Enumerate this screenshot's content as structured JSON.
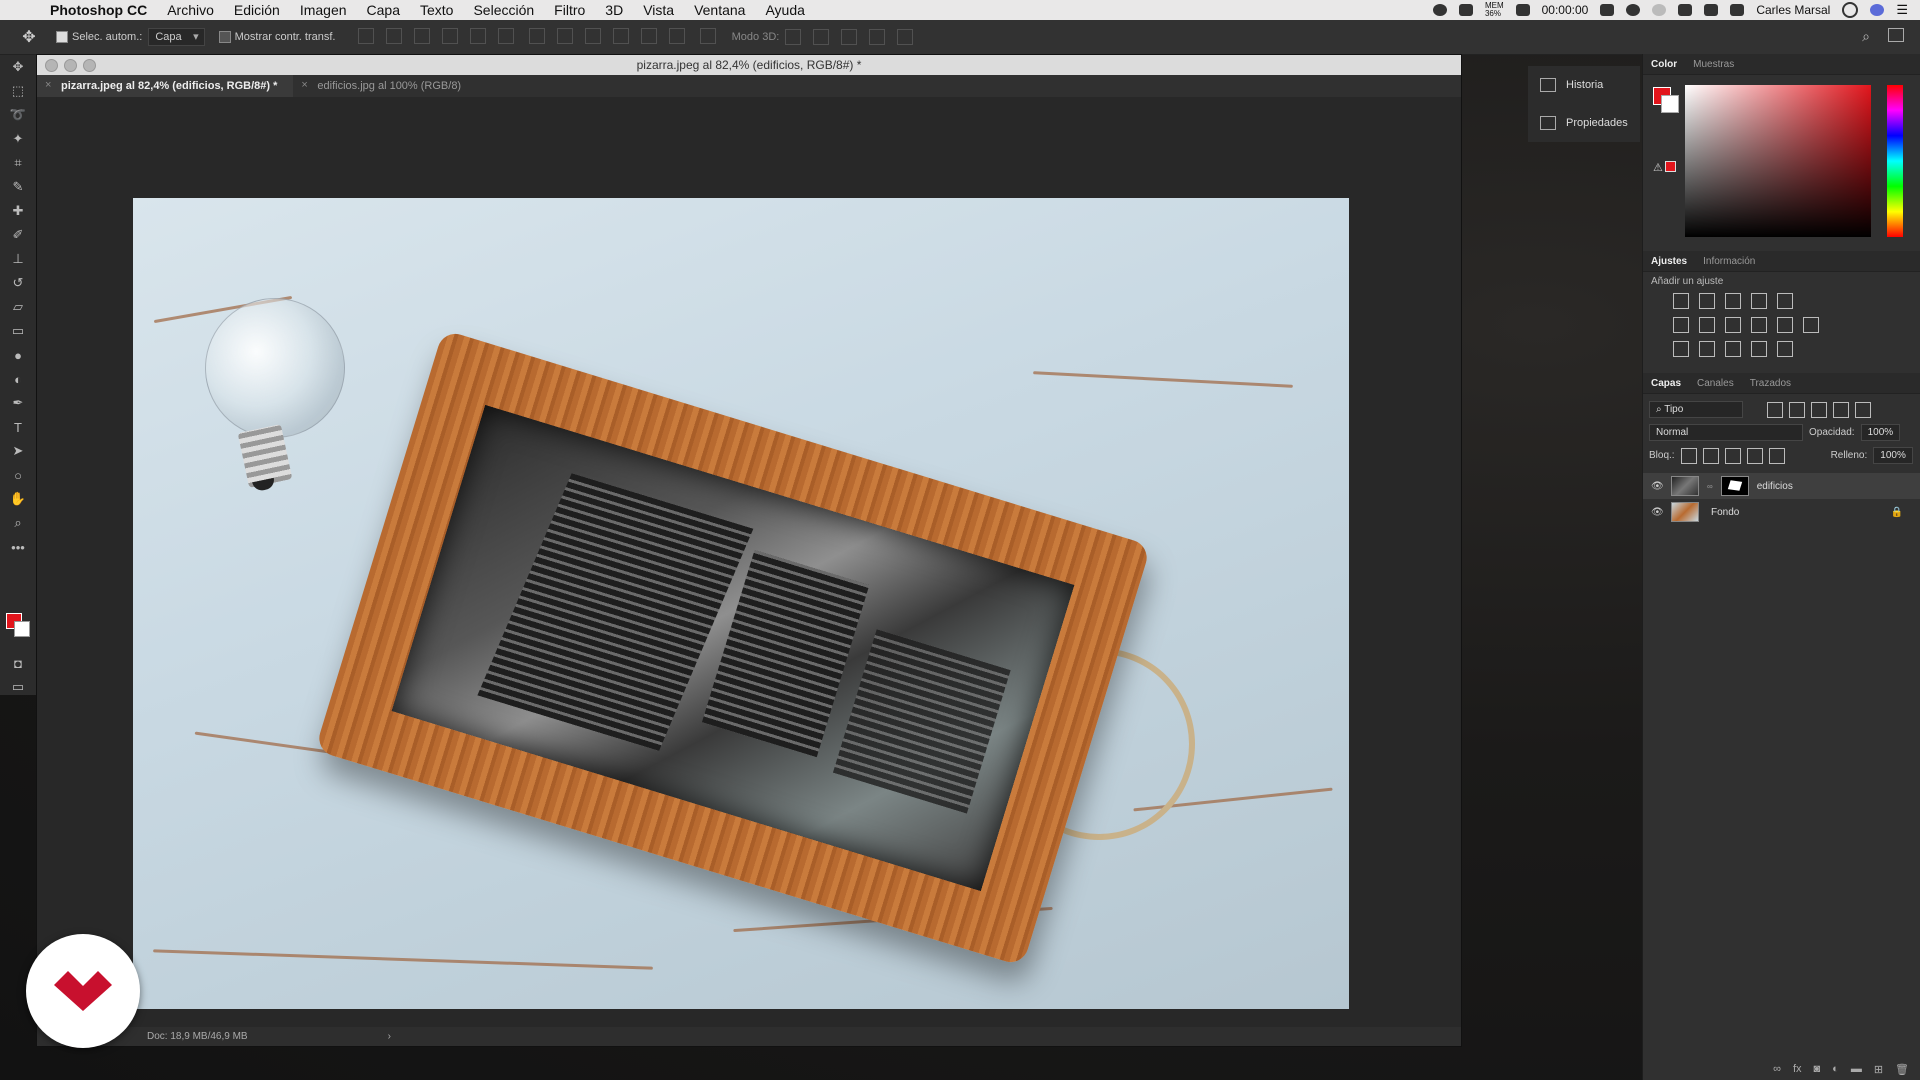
{
  "menubar": {
    "app_name": "Photoshop CC",
    "items": [
      "Archivo",
      "Edición",
      "Imagen",
      "Capa",
      "Texto",
      "Selección",
      "Filtro",
      "3D",
      "Vista",
      "Ventana",
      "Ayuda"
    ],
    "mem_label": "MEM",
    "mem_value": "36%",
    "timer": "00:00:00",
    "user": "Carles Marsal"
  },
  "options": {
    "auto_select_label": "Selec. autom.:",
    "auto_select_value": "Capa",
    "show_transform_label": "Mostrar contr. transf.",
    "mode3d_label": "Modo 3D:"
  },
  "document": {
    "window_title": "pizarra.jpeg al 82,4% (edificios, RGB/8#) *",
    "tabs": [
      {
        "label": "pizarra.jpeg al 82,4% (edificios, RGB/8#) *",
        "active": true
      },
      {
        "label": "edificios.jpg al 100% (RGB/8)",
        "active": false
      }
    ],
    "status": "Doc: 18,9 MB/46,9 MB",
    "status_arrow": "›"
  },
  "history_panel": {
    "items": [
      "Historia",
      "Propiedades"
    ]
  },
  "color_panel": {
    "tabs": [
      "Color",
      "Muestras"
    ],
    "foreground": "#e2151c",
    "background": "#ffffff"
  },
  "adjustments_panel": {
    "tabs": [
      "Ajustes",
      "Información"
    ],
    "subtitle": "Añadir un ajuste"
  },
  "layers_panel": {
    "tabs": [
      "Capas",
      "Canales",
      "Trazados"
    ],
    "filter_label": "Tipo",
    "blend_mode": "Normal",
    "opacity_label": "Opacidad:",
    "opacity_value": "100%",
    "lock_label": "Bloq.:",
    "fill_label": "Relleno:",
    "fill_value": "100%",
    "layers": [
      {
        "name": "edificios",
        "selected": true
      },
      {
        "name": "Fondo",
        "selected": false
      }
    ],
    "footer_icons": [
      "link-icon",
      "fx-icon",
      "mask-icon",
      "adjustment-icon",
      "folder-icon",
      "new-layer-icon",
      "trash-icon"
    ]
  }
}
